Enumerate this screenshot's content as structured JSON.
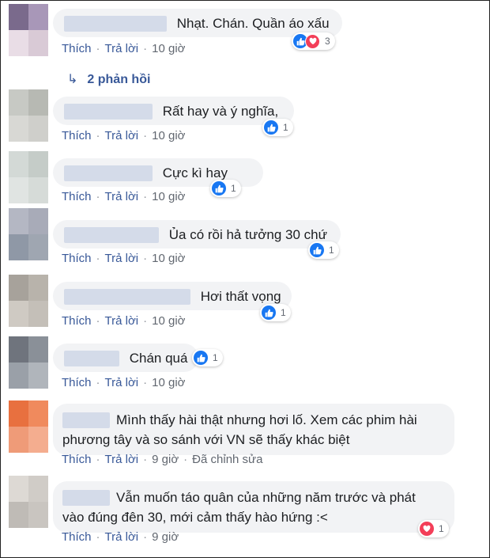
{
  "actions": {
    "like": "Thích",
    "reply": "Trả lời",
    "edited": "Đã chỉnh sửa"
  },
  "replies_link": {
    "label": "2 phản hồi"
  },
  "comments": [
    {
      "text": "Nhạt. Chán. Quần áo xấu",
      "time": "10 giờ",
      "reaction_count": "3"
    },
    {
      "text": "Rất hay và ý nghĩa,",
      "time": "10 giờ",
      "reaction_count": "1"
    },
    {
      "text": "Cực kì hay",
      "time": "10 giờ",
      "reaction_count": "1"
    },
    {
      "text": "Ủa có rồi hả tưởng 30 chứ",
      "time": "10 giờ",
      "reaction_count": "1"
    },
    {
      "text": "Hơi thất vọng",
      "time": "10 giờ",
      "reaction_count": "1"
    },
    {
      "text": "Chán quá",
      "time": "10 giờ",
      "reaction_count": "1"
    },
    {
      "line1": "Mình thấy hài thật nhưng hơi lố. Xem các phim hài",
      "line2": "phương tây và so sánh với VN sẽ thấy khác biệt",
      "time": "9 giờ"
    },
    {
      "line1": "Vẫn muốn táo quân của những năm trước và phát",
      "line2": "vào đúng đên 30, mới cảm thấy hào hứng :<",
      "time": "9 giờ",
      "reaction_count": "1"
    }
  ],
  "colors": {
    "like": "#1877f2",
    "heart": "#f33e58",
    "link": "#385898",
    "bubble": "#f2f3f5"
  },
  "icons": {
    "like": "thumbs-up-icon",
    "heart": "heart-icon",
    "reply_arrow": "reply-arrow-icon"
  }
}
